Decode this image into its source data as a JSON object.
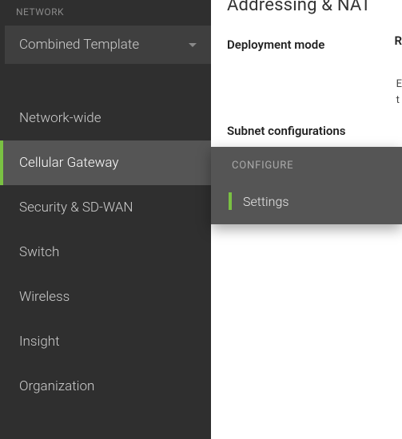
{
  "sidebar": {
    "section_label": "NETWORK",
    "template_selector": "Combined Template",
    "items": [
      {
        "label": "Network-wide"
      },
      {
        "label": "Cellular Gateway"
      },
      {
        "label": "Security & SD-WAN"
      },
      {
        "label": "Switch"
      },
      {
        "label": "Wireless"
      },
      {
        "label": "Insight"
      },
      {
        "label": "Organization"
      }
    ]
  },
  "submenu": {
    "header": "CONFIGURE",
    "items": [
      {
        "label": "Settings"
      }
    ]
  },
  "content": {
    "title": "Addressing & NAT",
    "deployment_mode_label": "Deployment mode",
    "subnet_label": "Subnet configurations",
    "right_frag_r": "R",
    "right_frag_e": "E",
    "right_frag_t": "t"
  }
}
